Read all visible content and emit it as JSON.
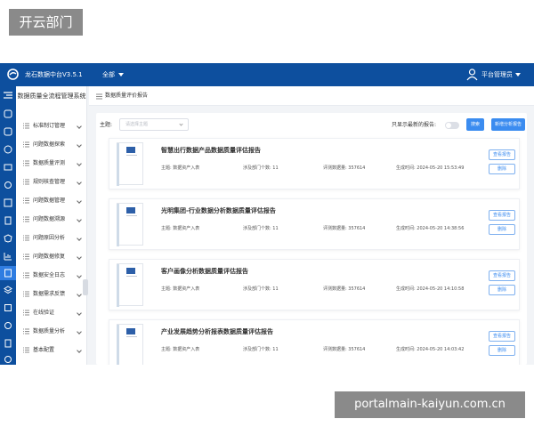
{
  "watermark": {
    "top": "开云部门",
    "bottom": "portalmain-kaiyun.com.cn"
  },
  "header": {
    "app_title": "龙石数据中台V3.5.1",
    "scope": "全部",
    "user": "平台管理员",
    "bg_color": "#0d4f9e"
  },
  "rail": {
    "icons": [
      "menu-toggle-icon",
      "database-icon",
      "cube-icon",
      "database-icon",
      "layers-icon",
      "gear-icon",
      "grid-icon",
      "book-icon",
      "shield-icon",
      "chart-icon",
      "report-icon",
      "stack-icon",
      "tag-icon",
      "swap-icon",
      "document-icon",
      "circle-icon"
    ]
  },
  "menu": {
    "title": "数据质量全流程管理系统",
    "items": [
      {
        "label": "标准制订管理"
      },
      {
        "label": "问题数据探索"
      },
      {
        "label": "数据质量评测"
      },
      {
        "label": "规则核查管理"
      },
      {
        "label": "问题数据管理"
      },
      {
        "label": "问题数据溯源"
      },
      {
        "label": "问题原因分析"
      },
      {
        "label": "问题数据修复"
      },
      {
        "label": "数据安全日志"
      },
      {
        "label": "数据需求反馈"
      },
      {
        "label": "在线验证"
      },
      {
        "label": "数据质量分析"
      },
      {
        "label": "基本配置"
      }
    ]
  },
  "tab": {
    "label": "数据质量评价报告"
  },
  "filter": {
    "subject_label": "主题:",
    "subject_placeholder": "请选择主题",
    "latest_label": "只显示最新的报告:",
    "search_button": "搜索",
    "new_button": "新增分析报告"
  },
  "reports": [
    {
      "title": "智慧出行数据产品数据质量评估报告",
      "subject": "主题: 数据资产入表",
      "depts": "涉及部门个数: 11",
      "count": "评测数据量: 357614",
      "time": "生成时间: 2024-05-20 15:53:49"
    },
    {
      "title": "光明集团-行业数据分析数据质量评估报告",
      "subject": "主题: 数据资产入表",
      "depts": "涉及部门个数: 11",
      "count": "评测数据量: 357614",
      "time": "生成时间: 2024-05-20 14:38:56"
    },
    {
      "title": "客户画像分析数据质量评估报告",
      "subject": "主题: 数据资产入表",
      "depts": "涉及部门个数: 11",
      "count": "评测数据量: 357614",
      "time": "生成时间: 2024-05-20 14:10:58"
    },
    {
      "title": "产业发展趋势分析报表数据质量评估报告",
      "subject": "主题: 数据资产入表",
      "depts": "涉及部门个数: 11",
      "count": "评测数据量: 357614",
      "time": "生成时间: 2024-05-20 14:03:42"
    }
  ],
  "card_actions": {
    "view": "查看报告",
    "delete": "删除"
  },
  "colors": {
    "accent": "#3b8cf0",
    "header": "#0d4f9e"
  }
}
